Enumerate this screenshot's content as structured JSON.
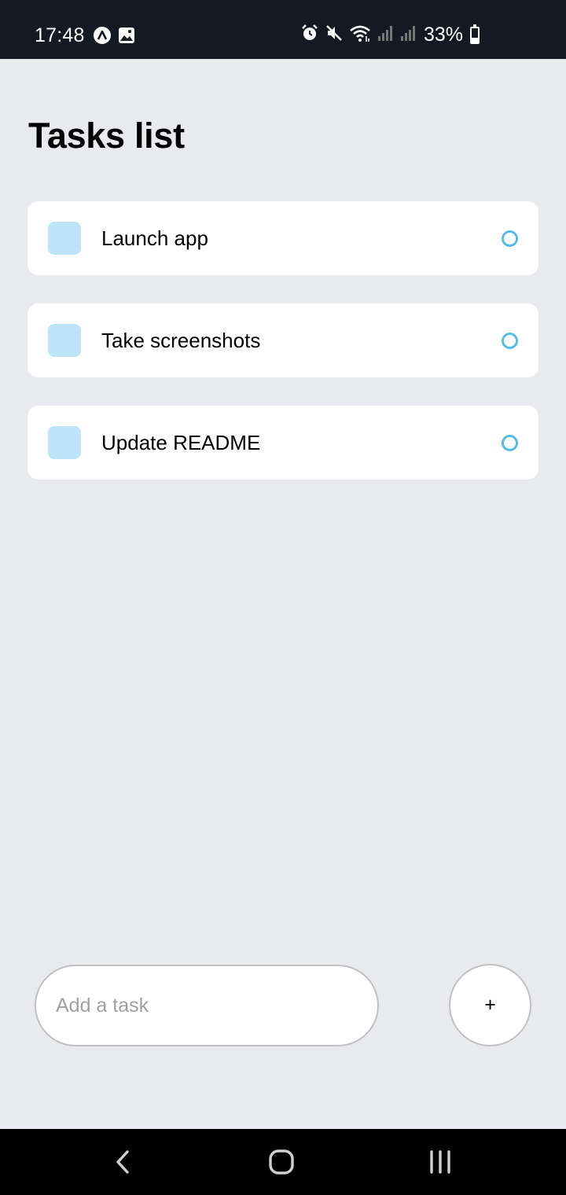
{
  "status_bar": {
    "time": "17:48",
    "battery_percent": "33%",
    "battery_level": 0.33,
    "left_icons": [
      "expo-icon",
      "gallery-icon"
    ],
    "right_icons": [
      "alarm-icon",
      "mute-icon",
      "wifi-icon",
      "signal-icon",
      "signal-icon"
    ]
  },
  "page": {
    "title": "Tasks list"
  },
  "tasks": [
    {
      "label": "Launch app",
      "checkbox_color": "#bde4f8",
      "status_color": "#55bce6"
    },
    {
      "label": "Take screenshots",
      "checkbox_color": "#bde4f8",
      "status_color": "#55bce6"
    },
    {
      "label": "Update README",
      "checkbox_color": "#bde4f8",
      "status_color": "#55bce6"
    }
  ],
  "composer": {
    "placeholder": "Add a task",
    "value": "",
    "add_label": "+"
  },
  "nav_bar": {
    "buttons": [
      "back-icon",
      "home-icon",
      "recent-apps-icon"
    ]
  },
  "colors": {
    "background": "#e8eaed",
    "status_bar": "#151923",
    "accent": "#55bce6"
  }
}
